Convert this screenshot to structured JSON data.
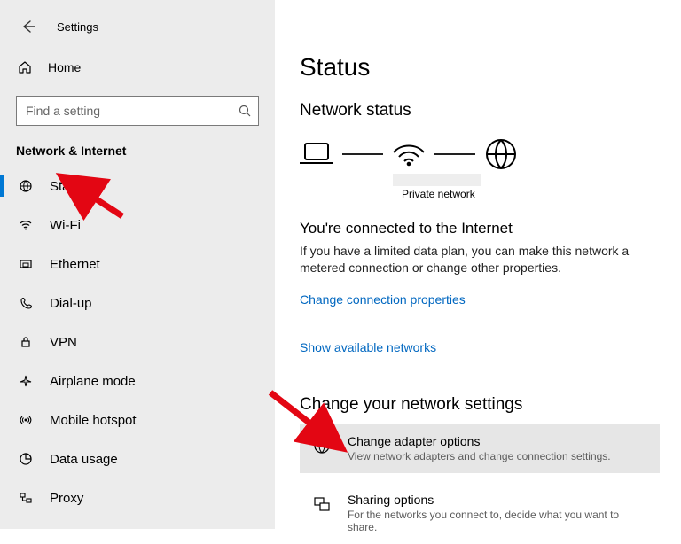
{
  "app_title": "Settings",
  "home_label": "Home",
  "search_placeholder": "Find a setting",
  "sidebar_section": "Network & Internet",
  "nav": {
    "status": "Status",
    "wifi": "Wi-Fi",
    "ethernet": "Ethernet",
    "dialup": "Dial-up",
    "vpn": "VPN",
    "airplane": "Airplane mode",
    "hotspot": "Mobile hotspot",
    "datausage": "Data usage",
    "proxy": "Proxy"
  },
  "content": {
    "heading": "Status",
    "network_status": "Network status",
    "diagram_label": "Private network",
    "connected_title": "You're connected to the Internet",
    "connected_desc": "If you have a limited data plan, you can make this network a metered connection or change other properties.",
    "link_properties": "Change connection properties",
    "link_available": "Show available networks",
    "section_change": "Change your network settings",
    "opt_adapter_title": "Change adapter options",
    "opt_adapter_desc": "View network adapters and change connection settings.",
    "opt_sharing_title": "Sharing options",
    "opt_sharing_desc": "For the networks you connect to, decide what you want to share."
  }
}
